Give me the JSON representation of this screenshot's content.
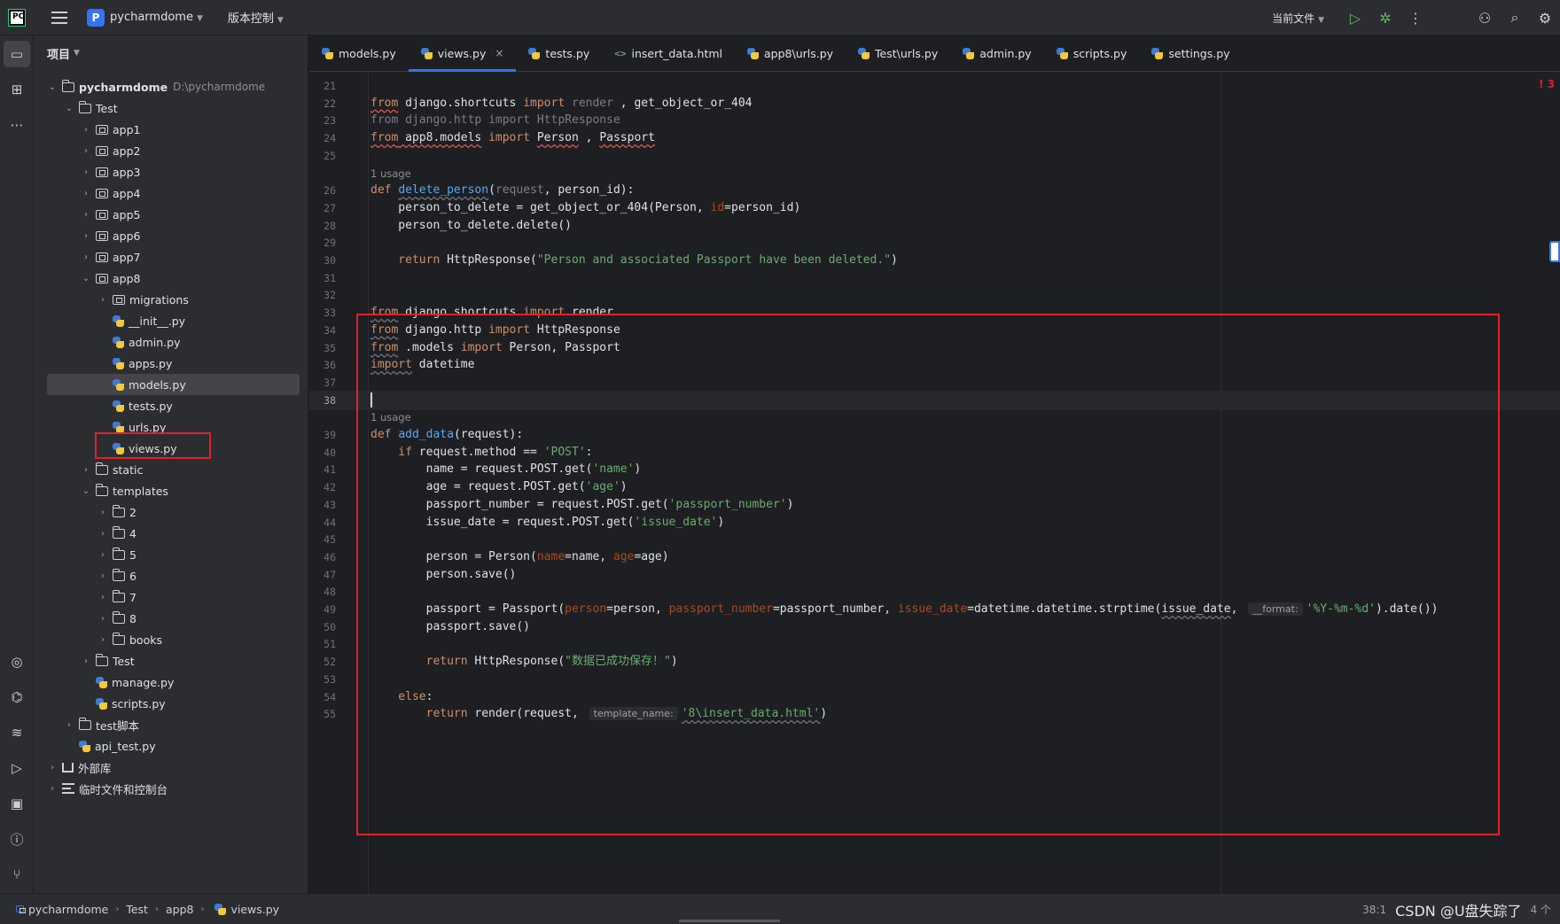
{
  "titlebar": {
    "logo": "PC",
    "project_badge": "P",
    "project_name": "pycharmdome",
    "vcs_label": "版本控制",
    "run_config": "当前文件"
  },
  "project_panel": {
    "header": "项目",
    "tree": [
      {
        "label": "pycharmdome",
        "hint": "D:\\pycharmdome",
        "icon": "folder",
        "depth": 0,
        "expanded": true
      },
      {
        "label": "Test",
        "icon": "folder",
        "depth": 1,
        "expanded": true
      },
      {
        "label": "app1",
        "icon": "module",
        "depth": 2,
        "expanded": false
      },
      {
        "label": "app2",
        "icon": "module",
        "depth": 2,
        "expanded": false
      },
      {
        "label": "app3",
        "icon": "module",
        "depth": 2,
        "expanded": false
      },
      {
        "label": "app4",
        "icon": "module",
        "depth": 2,
        "expanded": false
      },
      {
        "label": "app5",
        "icon": "module",
        "depth": 2,
        "expanded": false
      },
      {
        "label": "app6",
        "icon": "module",
        "depth": 2,
        "expanded": false
      },
      {
        "label": "app7",
        "icon": "module",
        "depth": 2,
        "expanded": false
      },
      {
        "label": "app8",
        "icon": "module",
        "depth": 2,
        "expanded": true
      },
      {
        "label": "migrations",
        "icon": "module",
        "depth": 3,
        "expanded": false
      },
      {
        "label": "__init__.py",
        "icon": "python",
        "depth": 3
      },
      {
        "label": "admin.py",
        "icon": "python",
        "depth": 3
      },
      {
        "label": "apps.py",
        "icon": "python",
        "depth": 3
      },
      {
        "label": "models.py",
        "icon": "python",
        "depth": 3,
        "selected": true
      },
      {
        "label": "tests.py",
        "icon": "python",
        "depth": 3
      },
      {
        "label": "urls.py",
        "icon": "python",
        "depth": 3
      },
      {
        "label": "views.py",
        "icon": "python",
        "depth": 3
      },
      {
        "label": "static",
        "icon": "folder",
        "depth": 2,
        "expanded": false
      },
      {
        "label": "templates",
        "icon": "folder",
        "depth": 2,
        "expanded": true
      },
      {
        "label": "2",
        "icon": "folder",
        "depth": 3,
        "expanded": false
      },
      {
        "label": "4",
        "icon": "folder",
        "depth": 3,
        "expanded": false
      },
      {
        "label": "5",
        "icon": "folder",
        "depth": 3,
        "expanded": false
      },
      {
        "label": "6",
        "icon": "folder",
        "depth": 3,
        "expanded": false
      },
      {
        "label": "7",
        "icon": "folder",
        "depth": 3,
        "expanded": false
      },
      {
        "label": "8",
        "icon": "folder",
        "depth": 3,
        "expanded": false
      },
      {
        "label": "books",
        "icon": "folder",
        "depth": 3,
        "expanded": false
      },
      {
        "label": "Test",
        "icon": "folder",
        "depth": 2,
        "expanded": false
      },
      {
        "label": "manage.py",
        "icon": "python",
        "depth": 2
      },
      {
        "label": "scripts.py",
        "icon": "python",
        "depth": 2
      },
      {
        "label": "test脚本",
        "icon": "folder",
        "depth": 1,
        "expanded": false
      },
      {
        "label": "api_test.py",
        "icon": "python",
        "depth": 1
      },
      {
        "label": "外部库",
        "icon": "library",
        "depth": 0,
        "expanded": false
      },
      {
        "label": "临时文件和控制台",
        "icon": "scratch",
        "depth": 0,
        "expanded": false
      }
    ]
  },
  "tabs": [
    {
      "label": "models.py",
      "icon": "python"
    },
    {
      "label": "views.py",
      "icon": "python",
      "active": true
    },
    {
      "label": "tests.py",
      "icon": "python"
    },
    {
      "label": "insert_data.html",
      "icon": "html"
    },
    {
      "label": "app8\\urls.py",
      "icon": "python"
    },
    {
      "label": "Test\\urls.py",
      "icon": "python"
    },
    {
      "label": "admin.py",
      "icon": "python"
    },
    {
      "label": "scripts.py",
      "icon": "python"
    },
    {
      "label": "settings.py",
      "icon": "python"
    }
  ],
  "editor": {
    "usage_label": "1 usage",
    "error_marker": "! 3",
    "lines": [
      {
        "n": "21",
        "tokens": []
      },
      {
        "n": "22",
        "tokens": [
          [
            "kw und",
            "from"
          ],
          [
            "",
            " django.shortcuts "
          ],
          [
            "kw",
            "import"
          ],
          [
            "dim",
            " render"
          ],
          [
            "",
            " , get_object_or_404"
          ]
        ]
      },
      {
        "n": "23",
        "tokens": [
          [
            "kw dim",
            "from"
          ],
          [
            "dim",
            " django.http "
          ],
          [
            "kw dim",
            "import"
          ],
          [
            "dim",
            " HttpResponse"
          ]
        ]
      },
      {
        "n": "24",
        "tokens": [
          [
            "kw und",
            "from"
          ],
          [
            "und",
            " app8.models"
          ],
          [
            "",
            " "
          ],
          [
            "kw",
            "import"
          ],
          [
            "",
            " "
          ],
          [
            "und",
            "Person"
          ],
          [
            "",
            " , "
          ],
          [
            "und",
            "Passport"
          ]
        ]
      },
      {
        "n": "25",
        "tokens": []
      },
      {
        "usage": true
      },
      {
        "n": "26",
        "tokens": [
          [
            "kw",
            "def"
          ],
          [
            "",
            " "
          ],
          [
            "fn unw",
            "delete_person"
          ],
          [
            "",
            "("
          ],
          [
            "dim",
            "request"
          ],
          [
            "",
            ", person_id):"
          ]
        ]
      },
      {
        "n": "27",
        "tokens": [
          [
            "",
            "    person_to_delete = get_object_or_404(Person, "
          ],
          [
            "prm",
            "id"
          ],
          [
            "",
            "=person_id)"
          ]
        ]
      },
      {
        "n": "28",
        "tokens": [
          [
            "",
            "    person_to_delete.delete()"
          ]
        ]
      },
      {
        "n": "29",
        "tokens": []
      },
      {
        "n": "30",
        "tokens": [
          [
            "kw",
            "    return"
          ],
          [
            "",
            " HttpResponse("
          ],
          [
            "str",
            "\"Person and associated Passport have been deleted.\""
          ],
          [
            "",
            ")"
          ]
        ]
      },
      {
        "n": "31",
        "tokens": []
      },
      {
        "n": "32",
        "tokens": []
      },
      {
        "n": "33",
        "tokens": [
          [
            "kw unw",
            "from"
          ],
          [
            "",
            " django.shortcuts "
          ],
          [
            "kw",
            "import"
          ],
          [
            "",
            " render"
          ]
        ]
      },
      {
        "n": "34",
        "tokens": [
          [
            "kw unw",
            "from"
          ],
          [
            "",
            " django.http "
          ],
          [
            "kw",
            "import"
          ],
          [
            "",
            " HttpResponse"
          ]
        ]
      },
      {
        "n": "35",
        "tokens": [
          [
            "kw unw",
            "from"
          ],
          [
            "",
            " .models "
          ],
          [
            "kw",
            "import"
          ],
          [
            "",
            " Person, Passport"
          ]
        ]
      },
      {
        "n": "36",
        "tokens": [
          [
            "kw unw",
            "import"
          ],
          [
            "",
            " datetime"
          ]
        ]
      },
      {
        "n": "37",
        "tokens": []
      },
      {
        "n": "38",
        "tokens": [],
        "current": true
      },
      {
        "usage": true
      },
      {
        "n": "39",
        "tokens": [
          [
            "kw",
            "def"
          ],
          [
            "",
            " "
          ],
          [
            "fn",
            "add_data"
          ],
          [
            "",
            "(request):"
          ]
        ]
      },
      {
        "n": "40",
        "tokens": [
          [
            "kw",
            "    if"
          ],
          [
            "",
            " request.method == "
          ],
          [
            "str",
            "'POST'"
          ],
          [
            "",
            ":"
          ]
        ]
      },
      {
        "n": "41",
        "tokens": [
          [
            "",
            "        name = request.POST.get("
          ],
          [
            "str",
            "'name'"
          ],
          [
            "",
            ")"
          ]
        ]
      },
      {
        "n": "42",
        "tokens": [
          [
            "",
            "        age = request.POST.get("
          ],
          [
            "str",
            "'age'"
          ],
          [
            "",
            ")"
          ]
        ]
      },
      {
        "n": "43",
        "tokens": [
          [
            "",
            "        passport_number = request.POST.get("
          ],
          [
            "str",
            "'passport_number'"
          ],
          [
            "",
            ")"
          ]
        ]
      },
      {
        "n": "44",
        "tokens": [
          [
            "",
            "        issue_date = request.POST.get("
          ],
          [
            "str",
            "'issue_date'"
          ],
          [
            "",
            ")"
          ]
        ]
      },
      {
        "n": "45",
        "tokens": []
      },
      {
        "n": "46",
        "tokens": [
          [
            "",
            "        person = Person("
          ],
          [
            "prm",
            "name"
          ],
          [
            "",
            "=name, "
          ],
          [
            "prm",
            "age"
          ],
          [
            "",
            "=age)"
          ]
        ]
      },
      {
        "n": "47",
        "tokens": [
          [
            "",
            "        person.save()"
          ]
        ]
      },
      {
        "n": "48",
        "tokens": []
      },
      {
        "n": "49",
        "tokens": [
          [
            "",
            "        passport = Passport("
          ],
          [
            "prm",
            "person"
          ],
          [
            "",
            "=person, "
          ],
          [
            "prm",
            "passport_number"
          ],
          [
            "",
            "=passport_number, "
          ],
          [
            "prm",
            "issue_date"
          ],
          [
            "",
            "=datetime.datetime.strptime("
          ],
          [
            "unw",
            "issue_date"
          ],
          [
            "",
            ", "
          ],
          [
            "hint",
            "__format:"
          ],
          [
            "str",
            "'%Y-%m-%d'"
          ],
          [
            "",
            ").date())"
          ]
        ]
      },
      {
        "n": "50",
        "tokens": [
          [
            "",
            "        passport.save()"
          ]
        ]
      },
      {
        "n": "51",
        "tokens": []
      },
      {
        "n": "52",
        "tokens": [
          [
            "kw",
            "        return"
          ],
          [
            "",
            " HttpResponse("
          ],
          [
            "str",
            "\"数据已成功保存！\""
          ],
          [
            "",
            ")"
          ]
        ]
      },
      {
        "n": "53",
        "tokens": []
      },
      {
        "n": "54",
        "tokens": [
          [
            "kw",
            "    else"
          ],
          [
            "",
            ":"
          ]
        ]
      },
      {
        "n": "55",
        "tokens": [
          [
            "kw",
            "        return"
          ],
          [
            "",
            " render(request, "
          ],
          [
            "hint",
            "template_name:"
          ],
          [
            "str unw",
            "'8\\insert_data.html'"
          ],
          [
            "",
            ")"
          ]
        ]
      }
    ]
  },
  "statusbar": {
    "breadcrumbs": [
      "pycharmdome",
      "Test",
      "app8",
      "views.py"
    ],
    "position": "38:1",
    "watermark": "CSDN @U盘失踪了",
    "extra": "4 个"
  },
  "colors": {
    "accent": "#3574f0",
    "highlight_box": "#e0222a",
    "keyword": "#cf8e6d",
    "function": "#56a8f5",
    "string": "#6aab73",
    "param": "#aa4926"
  }
}
